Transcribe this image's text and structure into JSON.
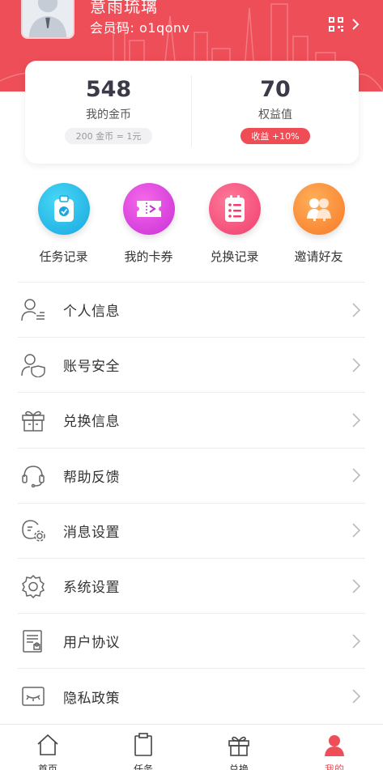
{
  "profile": {
    "username": "意雨琉璃",
    "member_code": "会员码: o1qonv"
  },
  "stats": {
    "coins_value": "548",
    "coins_label": "我的金币",
    "coins_rate": "200 金币 = 1元",
    "equity_value": "70",
    "equity_label": "权益值",
    "equity_badge": "收益 +10%"
  },
  "actions": [
    {
      "label": "任务记录",
      "icon": "task-clipboard-icon"
    },
    {
      "label": "我的卡券",
      "icon": "ticket-icon"
    },
    {
      "label": "兑换记录",
      "icon": "list-icon"
    },
    {
      "label": "邀请好友",
      "icon": "friends-icon"
    }
  ],
  "menu": [
    {
      "label": "个人信息",
      "icon": "user-info-icon"
    },
    {
      "label": "账号安全",
      "icon": "user-shield-icon"
    },
    {
      "label": "兑换信息",
      "icon": "gift-box-icon"
    },
    {
      "label": "帮助反馈",
      "icon": "headset-icon"
    },
    {
      "label": "消息设置",
      "icon": "message-settings-icon"
    },
    {
      "label": "系统设置",
      "icon": "gear-icon"
    },
    {
      "label": "用户协议",
      "icon": "document-icon"
    },
    {
      "label": "隐私政策",
      "icon": "eye-closed-icon"
    }
  ],
  "nav": [
    {
      "label": "首页",
      "icon": "home-icon"
    },
    {
      "label": "任务",
      "icon": "clipboard-icon"
    },
    {
      "label": "兑换",
      "icon": "gift-icon"
    },
    {
      "label": "我的",
      "icon": "person-icon",
      "active": true
    }
  ],
  "colors": {
    "brand": "#ee4e58",
    "text": "#333333"
  }
}
